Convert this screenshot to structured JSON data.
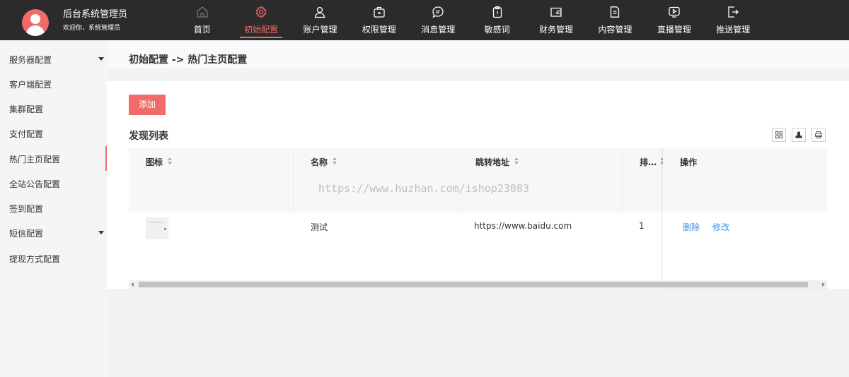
{
  "header": {
    "title": "后台系统管理员",
    "welcome": "欢迎你，系统管理员",
    "nav": [
      {
        "label": "首页",
        "icon": "home-icon"
      },
      {
        "label": "初始配置",
        "icon": "gear-icon",
        "active": true
      },
      {
        "label": "账户管理",
        "icon": "user-icon"
      },
      {
        "label": "权限管理",
        "icon": "briefcase-icon"
      },
      {
        "label": "消息管理",
        "icon": "chat-icon"
      },
      {
        "label": "敏感词",
        "icon": "clipboard-icon"
      },
      {
        "label": "财务管理",
        "icon": "wallet-icon"
      },
      {
        "label": "内容管理",
        "icon": "document-icon"
      },
      {
        "label": "直播管理",
        "icon": "play-icon"
      },
      {
        "label": "推送管理",
        "icon": "push-icon"
      }
    ]
  },
  "sidebar": {
    "items": [
      {
        "label": "服务器配置",
        "has_caret": true
      },
      {
        "label": "客户端配置"
      },
      {
        "label": "集群配置"
      },
      {
        "label": "支付配置"
      },
      {
        "label": "热门主页配置",
        "active": true
      },
      {
        "label": "全站公告配置"
      },
      {
        "label": "签到配置"
      },
      {
        "label": "短信配置",
        "has_caret": true
      },
      {
        "label": "提现方式配置"
      }
    ]
  },
  "breadcrumb": "初始配置 -> 热门主页配置",
  "toolbar": {
    "add_label": "添加",
    "list_title": "发现列表"
  },
  "table": {
    "columns": [
      "图标",
      "名称",
      "跳转地址",
      "排…",
      "操作"
    ],
    "rows": [
      {
        "name": "测试",
        "url": "https://www.baidu.com",
        "order": "1",
        "actions": [
          "删除",
          "修改"
        ]
      }
    ]
  },
  "watermark": "https://www.huzhan.com/ishop23083",
  "colors": {
    "accent": "#f26b6b",
    "header_bg": "#2b2b2b",
    "link": "#3d8fe0"
  }
}
